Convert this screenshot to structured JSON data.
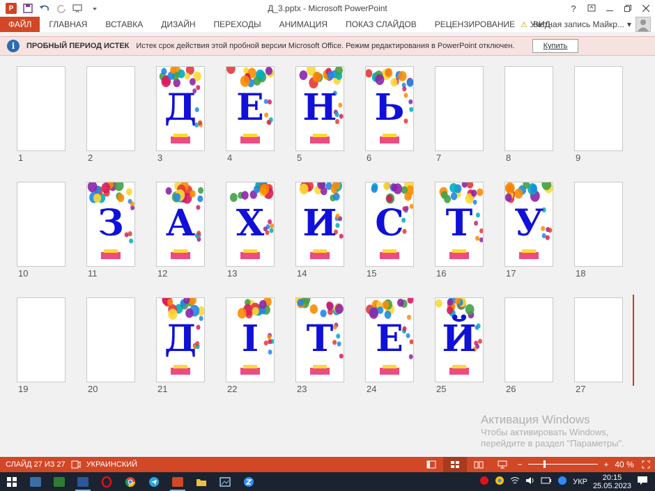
{
  "titlebar": {
    "title": "Д_3.pptx - Microsoft PowerPoint",
    "help": "?",
    "logo": "P"
  },
  "ribbon": {
    "file_tab": "ФАЙЛ",
    "tabs": [
      "ГЛАВНАЯ",
      "ВСТАВКА",
      "ДИЗАЙН",
      "ПЕРЕХОДЫ",
      "АНИМАЦИЯ",
      "ПОКАЗ СЛАЙДОВ",
      "РЕЦЕНЗИРОВАНИЕ",
      "ВИД"
    ],
    "account": "Учетная запись Майкр..."
  },
  "message_bar": {
    "title": "ПРОБНЫЙ ПЕРИОД ИСТЕК",
    "text": "Истек срок действия этой пробной версии Microsoft Office. Режим редактирования в PowerPoint отключен.",
    "button": "Купить"
  },
  "slides": [
    {
      "num": "1",
      "letter": ""
    },
    {
      "num": "2",
      "letter": ""
    },
    {
      "num": "3",
      "letter": "Д"
    },
    {
      "num": "4",
      "letter": "Е"
    },
    {
      "num": "5",
      "letter": "Н"
    },
    {
      "num": "6",
      "letter": "Ь"
    },
    {
      "num": "7",
      "letter": ""
    },
    {
      "num": "8",
      "letter": ""
    },
    {
      "num": "9",
      "letter": ""
    },
    {
      "num": "10",
      "letter": ""
    },
    {
      "num": "11",
      "letter": "З"
    },
    {
      "num": "12",
      "letter": "А"
    },
    {
      "num": "13",
      "letter": "Х"
    },
    {
      "num": "14",
      "letter": "И"
    },
    {
      "num": "15",
      "letter": "С"
    },
    {
      "num": "16",
      "letter": "Т"
    },
    {
      "num": "17",
      "letter": "У"
    },
    {
      "num": "18",
      "letter": ""
    },
    {
      "num": "19",
      "letter": ""
    },
    {
      "num": "20",
      "letter": ""
    },
    {
      "num": "21",
      "letter": "Д"
    },
    {
      "num": "22",
      "letter": "І"
    },
    {
      "num": "23",
      "letter": "Т"
    },
    {
      "num": "24",
      "letter": "Е"
    },
    {
      "num": "25",
      "letter": "Й"
    },
    {
      "num": "26",
      "letter": ""
    },
    {
      "num": "27",
      "letter": ""
    }
  ],
  "activation": {
    "title": "Активация Windows",
    "line1": "Чтобы активировать Windows,",
    "line2": "перейдите в раздел \"Параметры\"."
  },
  "statusbar": {
    "slide_info": "СЛАЙД 27 ИЗ 27",
    "language": "УКРАИНСКИЙ",
    "zoom": "40 %",
    "zoom_level": 0.4
  },
  "taskbar": {
    "lang": "УКР",
    "time": "20:15",
    "date": "25.05.2023"
  },
  "colors": {
    "accent": "#d24726",
    "letter": "#1010d8"
  }
}
